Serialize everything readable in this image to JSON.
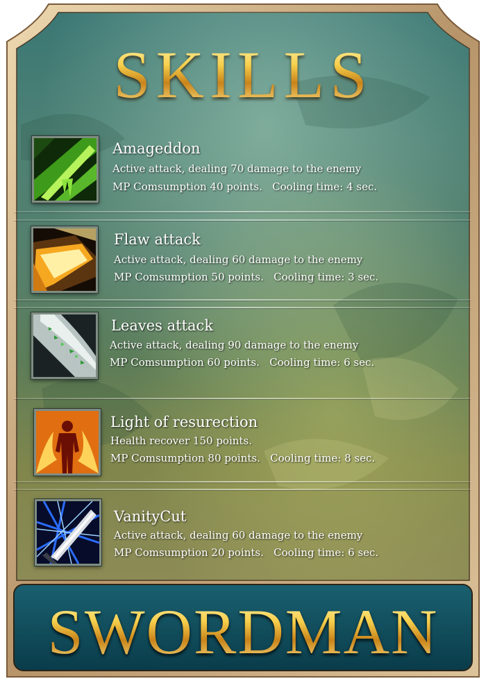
{
  "title": "SKILLS",
  "class_name": "SWORDMAN",
  "colors": {
    "gold": "#f2c33a",
    "frame": "#c9a979",
    "banner": "#0e4a59",
    "text": "#ffffff"
  },
  "skills": [
    {
      "icon": "green-blade-icon",
      "name": "Amageddon",
      "line1": "Active attack, dealing 70 damage to the enemy",
      "line2": "MP Comsumption 40 points.   Cooling time: 4 sec."
    },
    {
      "icon": "golden-slash-icon",
      "name": "Flaw attack",
      "line1": "Active attack, dealing 60 damage to the enemy",
      "line2": "MP Comsumption 50 points.   Cooling time: 3 sec."
    },
    {
      "icon": "leaves-wind-icon",
      "name": "Leaves attack",
      "line1": "Active attack, dealing 90 damage to the enemy",
      "line2": "MP Comsumption 60 points.   Cooling time: 6 sec."
    },
    {
      "icon": "fire-figure-icon",
      "name": "Light of resurection",
      "line1": "Health recover 150 points.",
      "line2": "MP Comsumption 80 points.   Cooling time: 8 sec."
    },
    {
      "icon": "lightning-sword-icon",
      "name": "VanityCut",
      "line1": "Active attack, dealing 60 damage to the enemy",
      "line2": "MP Comsumption 20 points.   Cooling time: 6 sec."
    }
  ]
}
